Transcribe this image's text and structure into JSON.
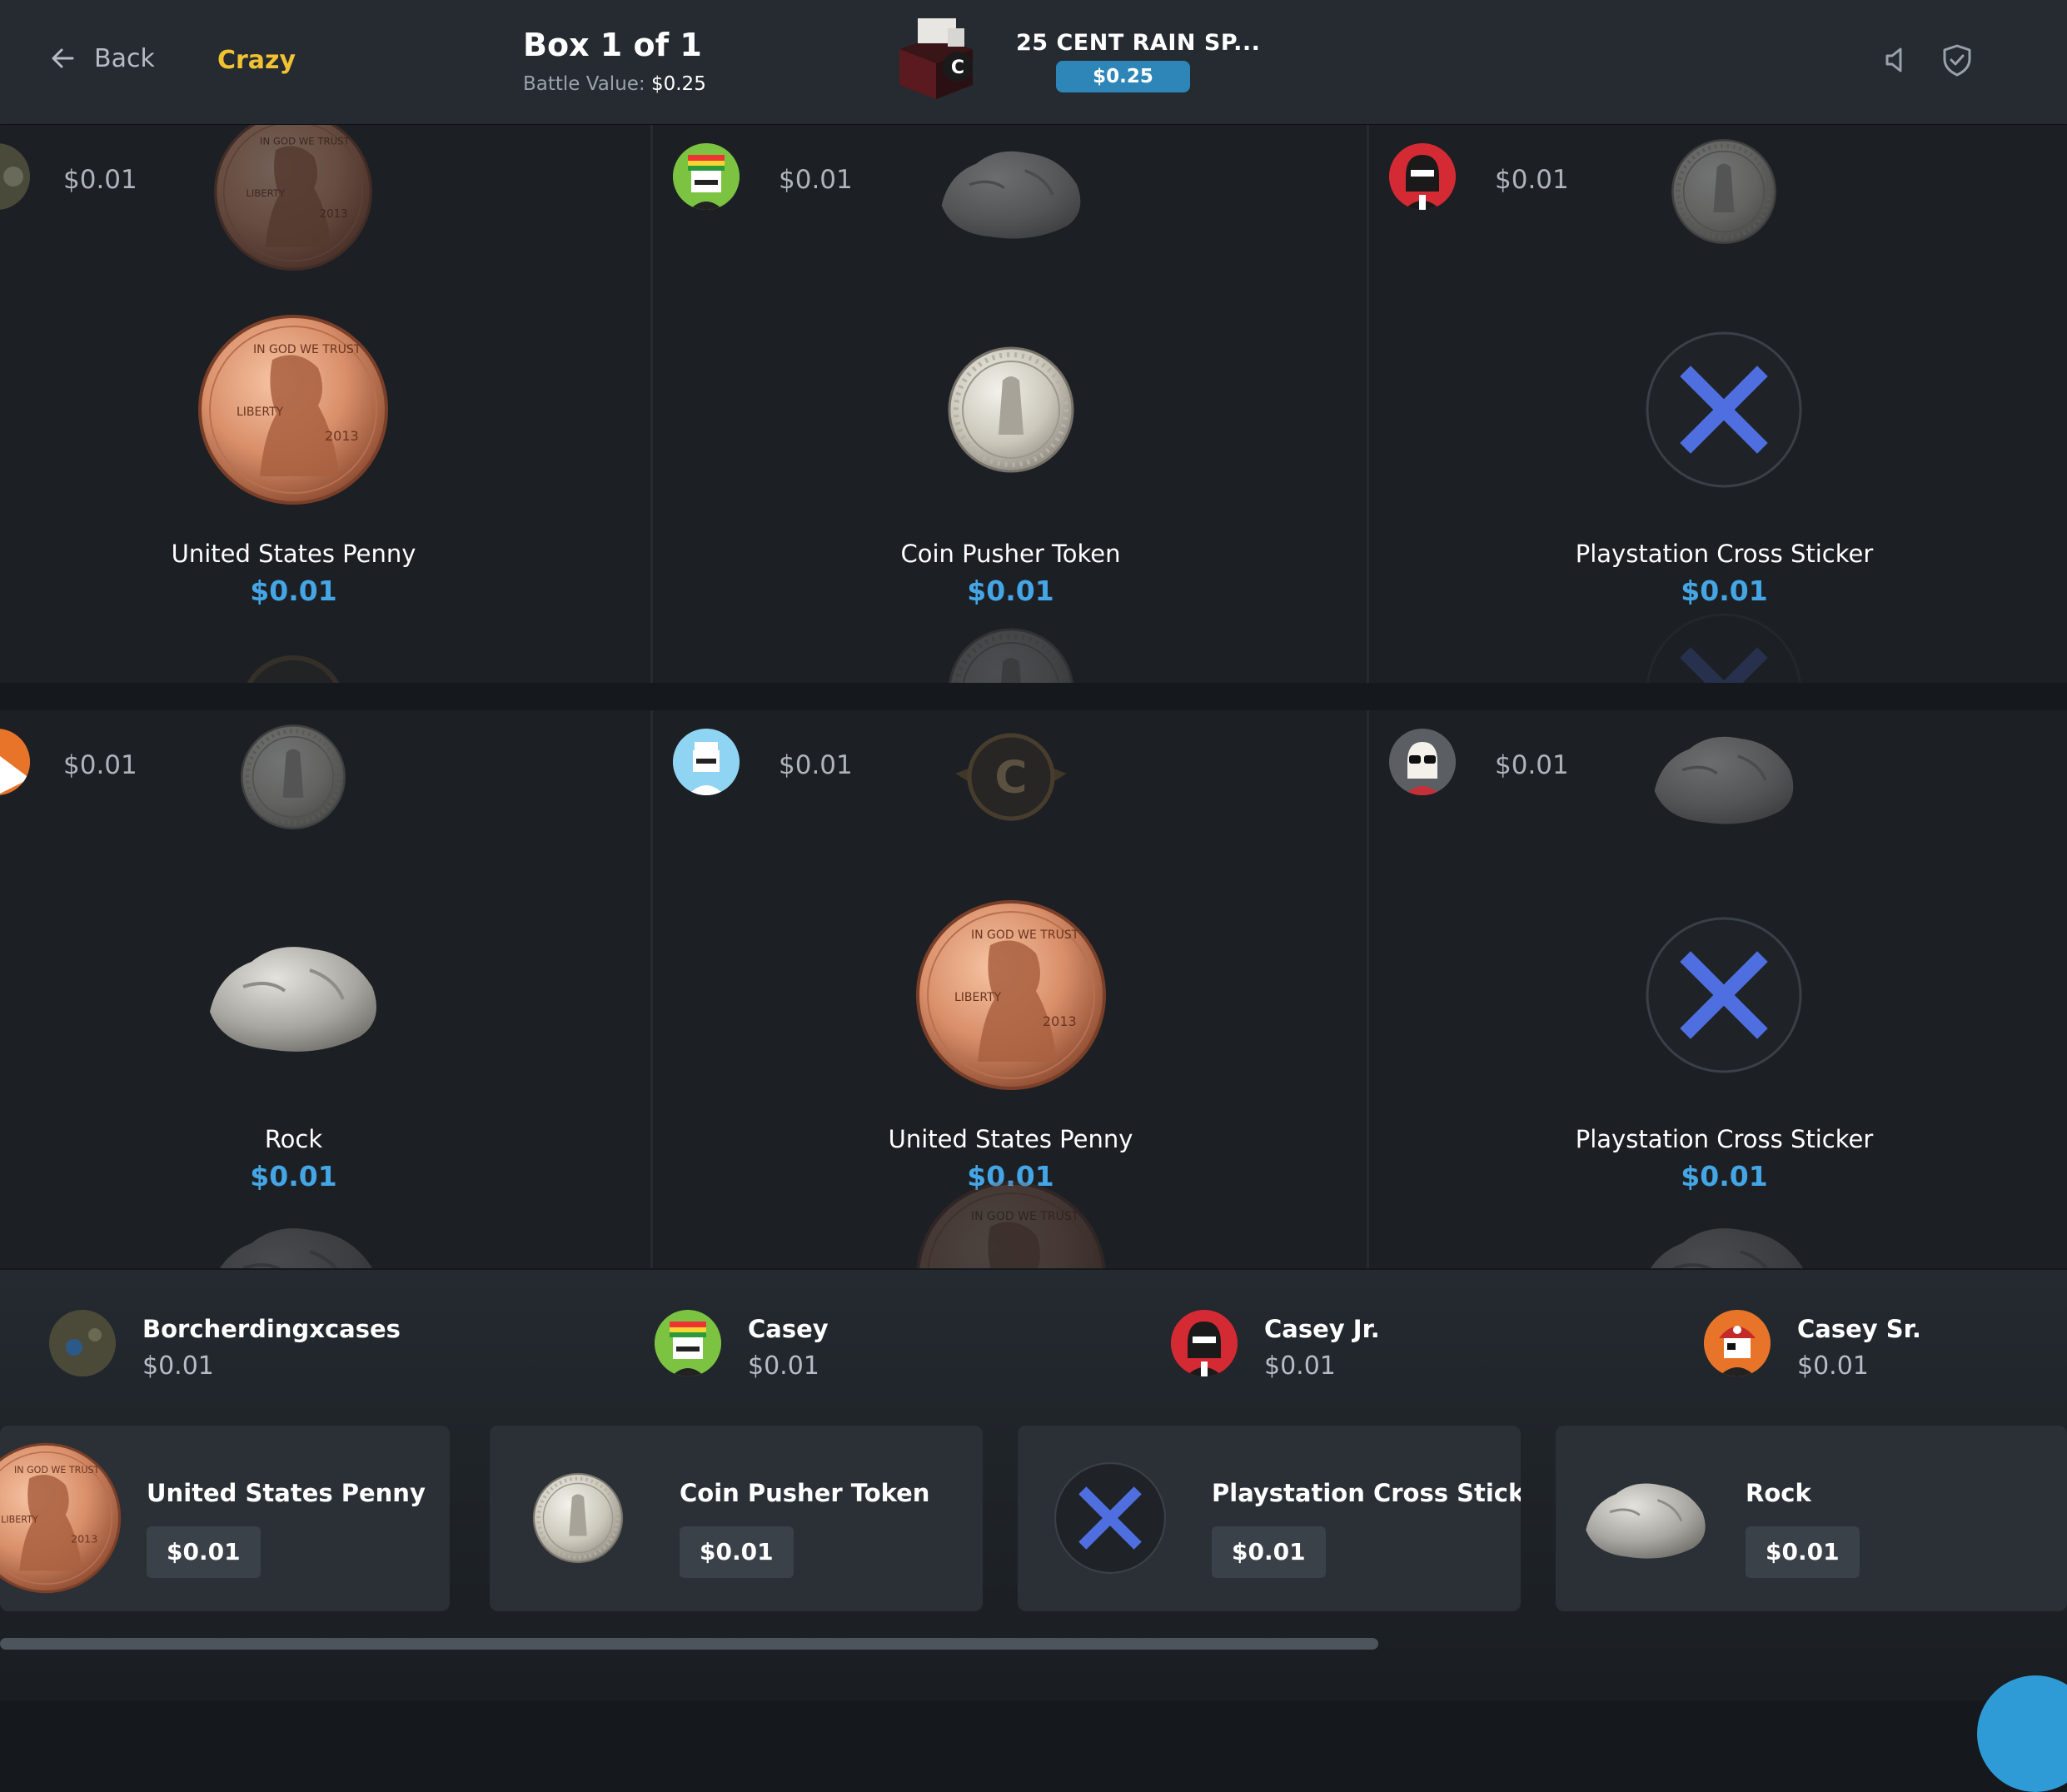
{
  "header": {
    "back_label": "Back",
    "mode": "Crazy",
    "box_count": "Box 1 of 1",
    "battle_value_label": "Battle Value:",
    "battle_value": "$0.25",
    "case_name": "25 CENT RAIN SP...",
    "case_price": "$0.25",
    "icons": [
      "speaker-icon",
      "shield-check-icon"
    ]
  },
  "rows": [
    {
      "cells": [
        {
          "small_price": "$0.01",
          "item": "United States Penny",
          "price": "$0.01",
          "avatar": "dark-avatar"
        },
        {
          "small_price": "$0.01",
          "item": "Coin Pusher Token",
          "price": "$0.01",
          "avatar": "rasta-avatar"
        },
        {
          "small_price": "$0.01",
          "item": "Playstation Cross Sticker",
          "price": "$0.01",
          "avatar": "ninja-avatar"
        }
      ]
    },
    {
      "cells": [
        {
          "small_price": "$0.01",
          "item": "Rock",
          "price": "$0.01",
          "avatar": "pirate-avatar"
        },
        {
          "small_price": "$0.01",
          "item": "United States Penny",
          "price": "$0.01",
          "avatar": "chef-avatar"
        },
        {
          "small_price": "$0.01",
          "item": "Playstation Cross Sticker",
          "price": "$0.01",
          "avatar": "sunglasses-avatar"
        }
      ]
    }
  ],
  "players": [
    {
      "name": "Borcherdingxcases",
      "value": "$0.01"
    },
    {
      "name": "Casey",
      "value": "$0.01"
    },
    {
      "name": "Casey Jr.",
      "value": "$0.01"
    },
    {
      "name": "Casey Sr.",
      "value": "$0.01"
    }
  ],
  "cards": [
    {
      "name": "United States Penny",
      "price": "$0.01"
    },
    {
      "name": "Coin Pusher Token",
      "price": "$0.01"
    },
    {
      "name": "Playstation Cross Sticker",
      "price": "$0.01"
    },
    {
      "name": "Rock",
      "price": "$0.01"
    }
  ],
  "colors": {
    "accent_yellow": "#f1c232",
    "price_blue": "#45a6e6",
    "case_price_bg": "#2e86b8",
    "cross_blue": "#4f6fe0"
  }
}
